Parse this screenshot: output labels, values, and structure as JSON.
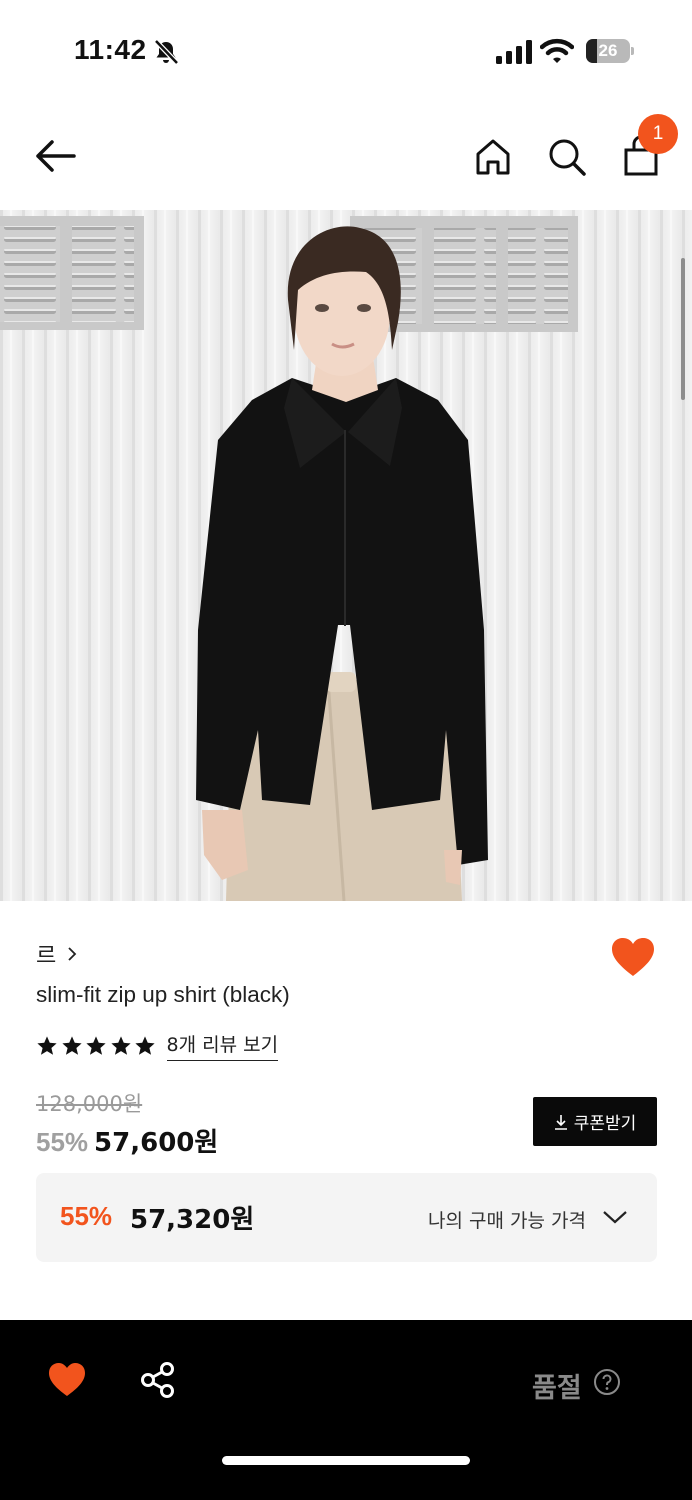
{
  "status_bar": {
    "time": "11:42",
    "battery_level": "26",
    "icons": [
      "bell-slash-icon",
      "cellular-signal-icon",
      "wifi-icon",
      "battery-icon"
    ]
  },
  "nav": {
    "icons": [
      "arrow-left-icon",
      "home-icon",
      "search-icon",
      "shopping-bag-icon"
    ],
    "cart_count": "1"
  },
  "product": {
    "brand": "르",
    "title": "slim-fit zip up shirt (black)",
    "rating_stars": 5,
    "review_link": "8개 리뷰 보기",
    "original_price": "128,000원",
    "discount_rate": "55%",
    "sale_price": "57,600원",
    "coupon_label": "쿠폰받기",
    "wishlisted": true
  },
  "my_price": {
    "discount_rate": "55%",
    "price": "57,320원",
    "label": "나의 구매 가능 가격"
  },
  "bottom_bar": {
    "status": "품절",
    "icons": [
      "heart-icon",
      "share-icon",
      "question-circle-icon"
    ]
  },
  "colors": {
    "accent": "#f2541d",
    "bottom_bar_bg": "#000000",
    "price_box_bg": "#f4f4f4"
  }
}
